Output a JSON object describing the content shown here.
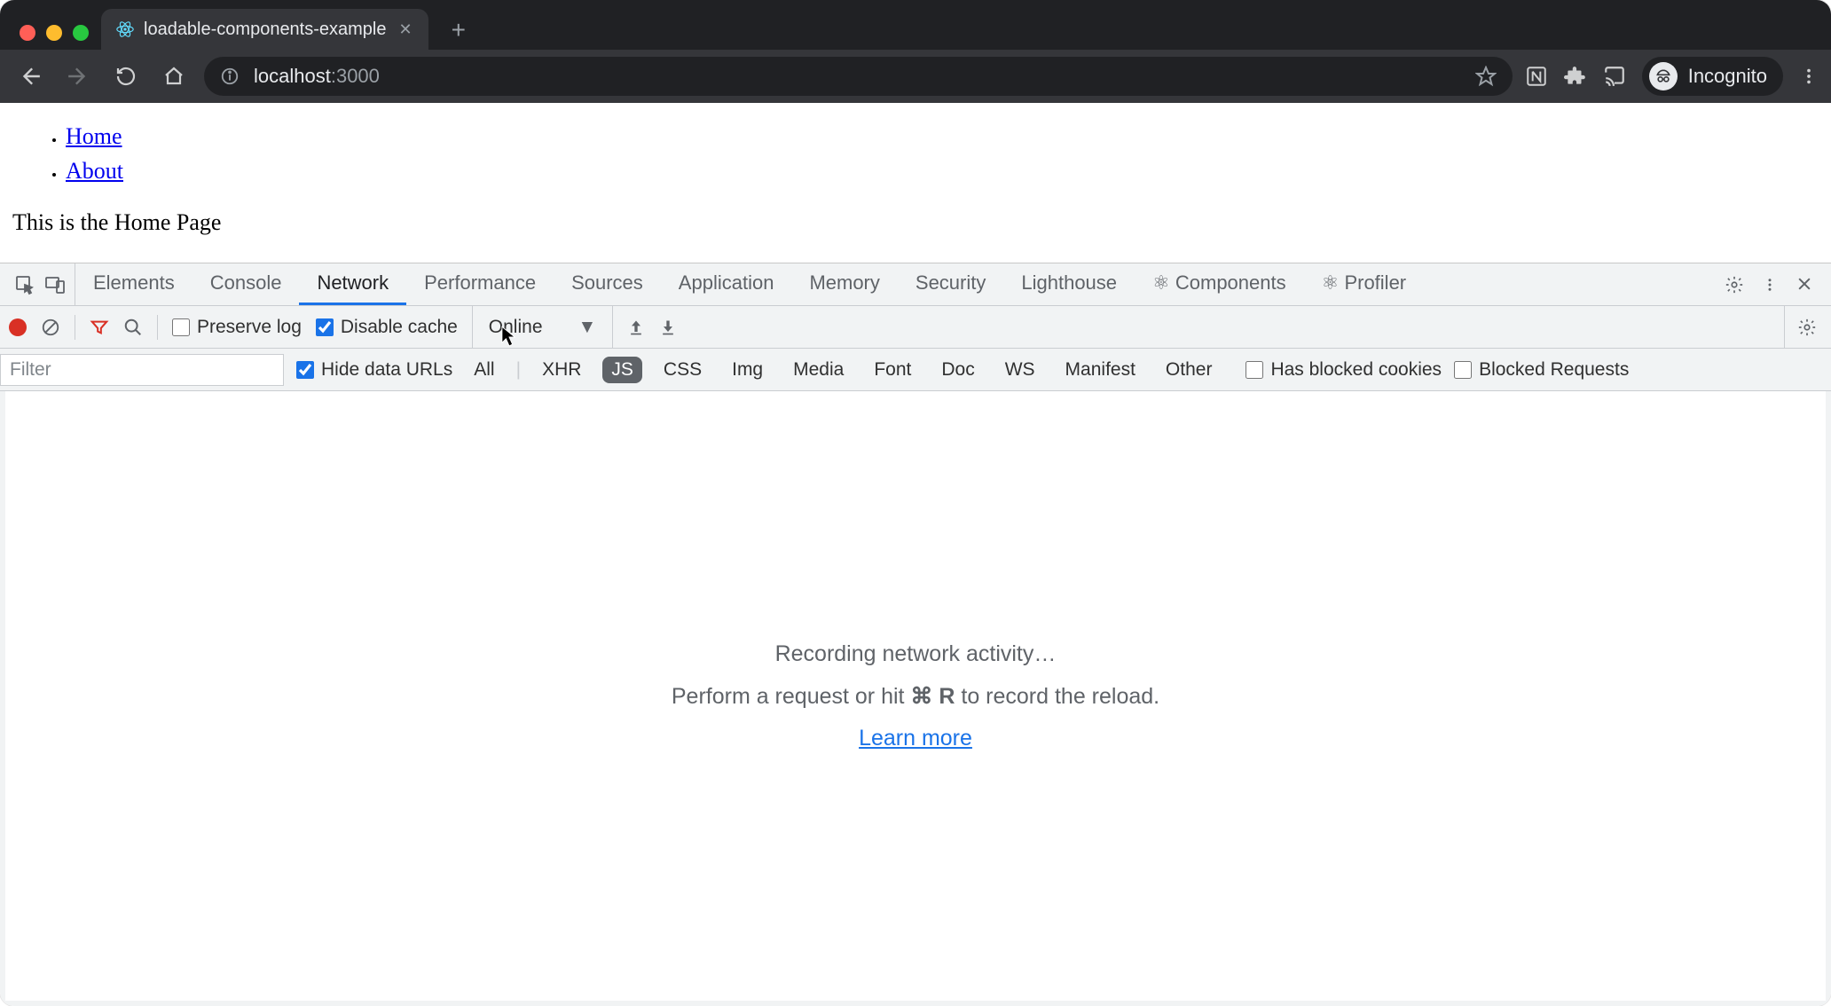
{
  "browser": {
    "tab_title": "loadable-components-example",
    "url_host": "localhost",
    "url_port": ":3000",
    "incognito_label": "Incognito"
  },
  "page": {
    "nav_links": [
      "Home",
      "About"
    ],
    "body_text": "This is the Home Page"
  },
  "devtools": {
    "tabs": [
      "Elements",
      "Console",
      "Network",
      "Performance",
      "Sources",
      "Application",
      "Memory",
      "Security",
      "Lighthouse",
      "⚛ Components",
      "⚛ Profiler"
    ],
    "active_tab": "Network",
    "toolbar": {
      "preserve_log_label": "Preserve log",
      "preserve_log_checked": false,
      "disable_cache_label": "Disable cache",
      "disable_cache_checked": true,
      "throttling": "Online"
    },
    "filterbar": {
      "filter_placeholder": "Filter",
      "hide_data_urls_label": "Hide data URLs",
      "hide_data_urls_checked": true,
      "types": [
        "All",
        "XHR",
        "JS",
        "CSS",
        "Img",
        "Media",
        "Font",
        "Doc",
        "WS",
        "Manifest",
        "Other"
      ],
      "active_type": "JS",
      "has_blocked_cookies_label": "Has blocked cookies",
      "has_blocked_cookies_checked": false,
      "blocked_requests_label": "Blocked Requests",
      "blocked_requests_checked": false
    },
    "empty_state": {
      "line1": "Recording network activity…",
      "line2_pre": "Perform a request or hit ",
      "line2_kbd": "⌘ R",
      "line2_post": " to record the reload.",
      "learn_more": "Learn more"
    }
  }
}
